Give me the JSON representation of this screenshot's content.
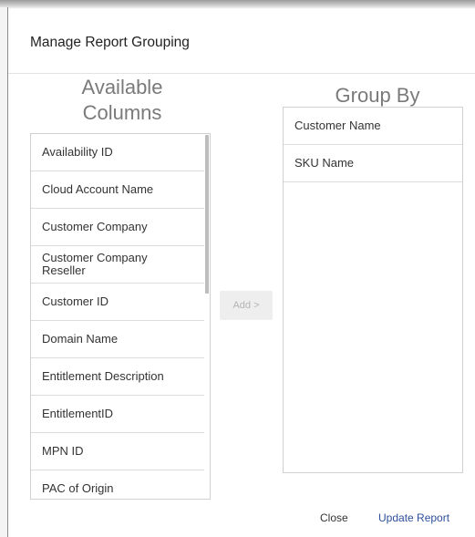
{
  "dialog": {
    "title": "Manage Report Grouping"
  },
  "available": {
    "heading_line1": "Available",
    "heading_line2": "Columns",
    "items": [
      {
        "label": "Availability ID"
      },
      {
        "label": "Cloud Account Name"
      },
      {
        "label": "Customer Company"
      },
      {
        "label": "Customer Company Reseller"
      },
      {
        "label": "Customer ID"
      },
      {
        "label": "Domain Name"
      },
      {
        "label": "Entitlement Description"
      },
      {
        "label": "EntitlementID"
      },
      {
        "label": "MPN ID"
      },
      {
        "label": "PAC of Origin"
      }
    ]
  },
  "group_by": {
    "heading": "Group By",
    "items": [
      {
        "label": "Customer Name"
      },
      {
        "label": "SKU Name"
      }
    ]
  },
  "actions": {
    "add_label": "Add >",
    "close_label": "Close",
    "update_label": "Update Report"
  },
  "colors": {
    "accent": "#2d4f9c",
    "heading": "#7a7a7a",
    "disabled_button_bg": "#eeeeee",
    "disabled_button_text": "#b5b5b5"
  }
}
